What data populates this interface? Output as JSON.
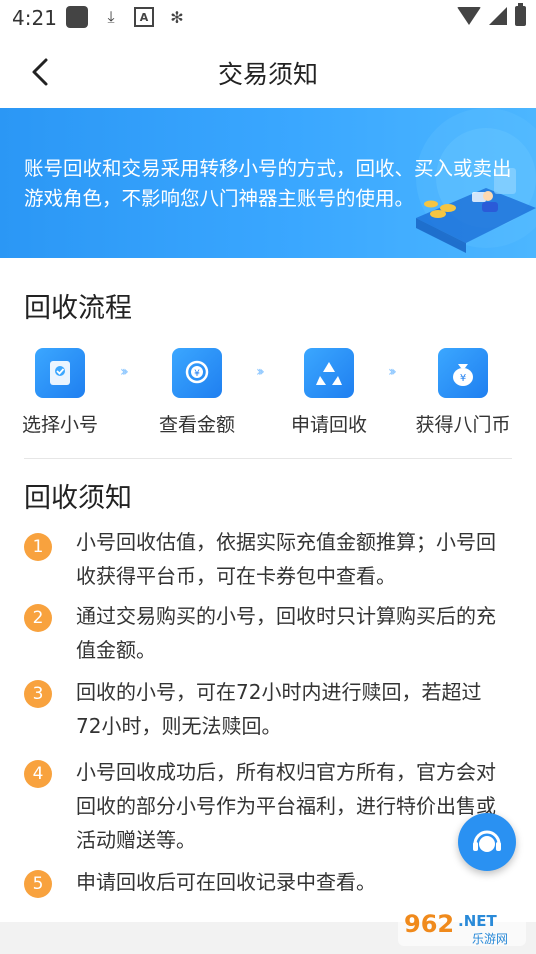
{
  "status_bar": {
    "time": "4:21"
  },
  "nav": {
    "title": "交易须知"
  },
  "banner": {
    "text": "账号回收和交易采用转移小号的方式，回收、买入或卖出游戏角色，不影响您八门神器主账号的使用。"
  },
  "flow_section": {
    "title": "回收流程",
    "steps": [
      {
        "label": "选择小号",
        "icon": "account-card-icon"
      },
      {
        "label": "查看金额",
        "icon": "coin-search-icon"
      },
      {
        "label": "申请回收",
        "icon": "recycle-icon"
      },
      {
        "label": "获得八门币",
        "icon": "money-bag-icon"
      }
    ]
  },
  "notice_section": {
    "title": "回收须知",
    "items": [
      {
        "num": "1",
        "text": "小号回收估值，依据实际充值金额推算；小号回收获得平台币，可在卡券包中查看。"
      },
      {
        "num": "2",
        "text": "通过交易购买的小号，回收时只计算购买后的充值金额。"
      },
      {
        "num": "3",
        "text": "回收的小号，可在72小时内进行赎回，若超过72小时，则无法赎回。"
      },
      {
        "num": "4",
        "text": "小号回收成功后，所有权归官方所有，官方会对回收的部分小号作为平台福利，进行特价出售或活动赠送等。"
      },
      {
        "num": "5",
        "text": "申请回收后可在回收记录中查看。"
      }
    ]
  },
  "watermark": {
    "text_main": "962.NET",
    "text_sub": "乐游网"
  },
  "colors": {
    "primary": "#2b97f5",
    "badge": "#f8a23e"
  }
}
